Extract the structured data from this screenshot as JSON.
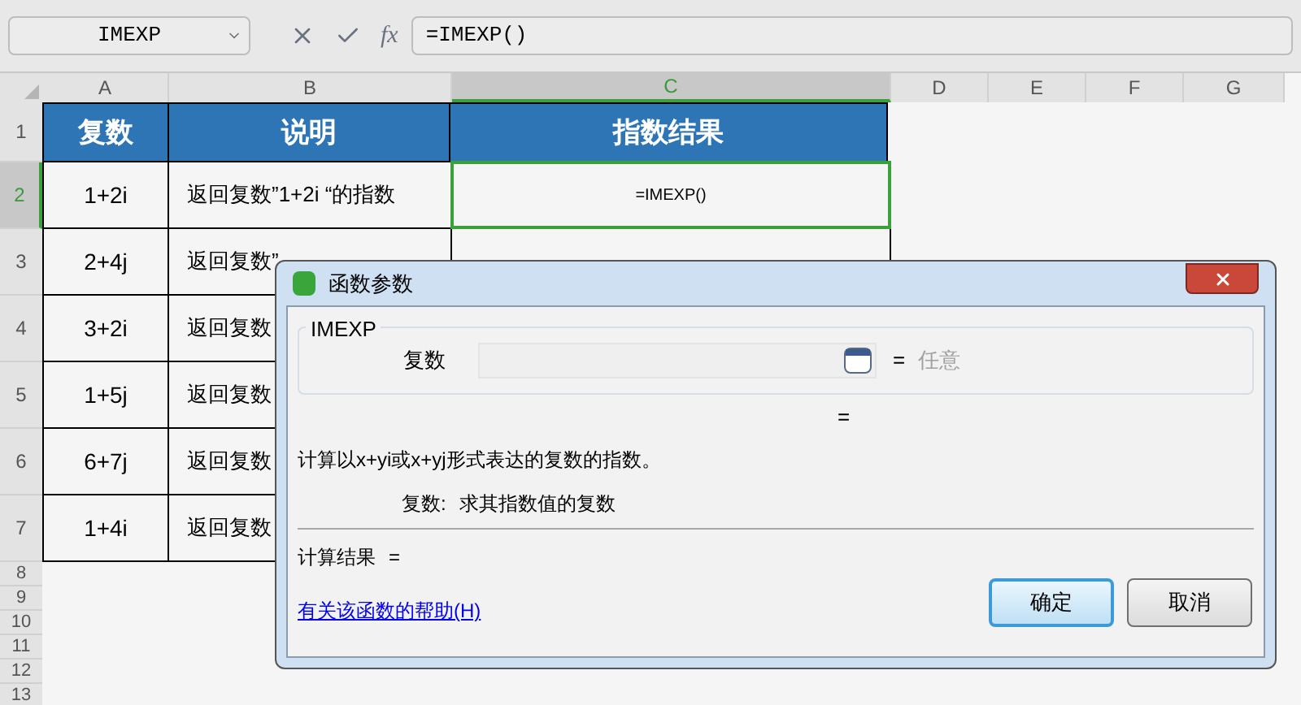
{
  "formula_bar": {
    "name_box": "IMEXP",
    "fx": "fx",
    "formula": "=IMEXP()"
  },
  "columns": [
    {
      "label": "A",
      "selected": false
    },
    {
      "label": "B",
      "selected": false
    },
    {
      "label": "C",
      "selected": true
    },
    {
      "label": "D",
      "selected": false
    },
    {
      "label": "E",
      "selected": false
    },
    {
      "label": "F",
      "selected": false
    },
    {
      "label": "G",
      "selected": false
    }
  ],
  "row_numbers": [
    {
      "label": "1",
      "selected": false
    },
    {
      "label": "2",
      "selected": true
    },
    {
      "label": "3",
      "selected": false
    },
    {
      "label": "4",
      "selected": false
    },
    {
      "label": "5",
      "selected": false
    },
    {
      "label": "6",
      "selected": false
    },
    {
      "label": "7",
      "selected": false
    },
    {
      "label": "8",
      "selected": false
    },
    {
      "label": "9",
      "selected": false
    },
    {
      "label": "10",
      "selected": false
    },
    {
      "label": "11",
      "selected": false
    },
    {
      "label": "12",
      "selected": false
    },
    {
      "label": "13",
      "selected": false
    }
  ],
  "table": {
    "header": [
      "复数",
      "说明",
      "指数结果"
    ],
    "rows": [
      [
        "1+2i",
        "返回复数”1+2i “的指数",
        "=IMEXP()"
      ],
      [
        "2+4j",
        "返回复数”",
        ""
      ],
      [
        "3+2i",
        "返回复数"
      ],
      [
        "1+5j",
        "返回复数"
      ],
      [
        "6+7j",
        "返回复数"
      ],
      [
        "1+4i",
        "返回复数"
      ]
    ]
  },
  "dialog": {
    "title": "函数参数",
    "function_name": "IMEXP",
    "argument": {
      "label": "复数",
      "equals": "=",
      "value_hint": "任意"
    },
    "result_equals": "=",
    "description": "计算以x+yi或x+yj形式表达的复数的指数。",
    "argument_help": {
      "label": "复数:",
      "text": "求其指数值的复数"
    },
    "result": {
      "label": "计算结果",
      "equals": "="
    },
    "help_link": "有关该函数的帮助(H)",
    "buttons": [
      {
        "label": "确定",
        "default": true
      },
      {
        "label": "取消",
        "default": false
      }
    ]
  }
}
